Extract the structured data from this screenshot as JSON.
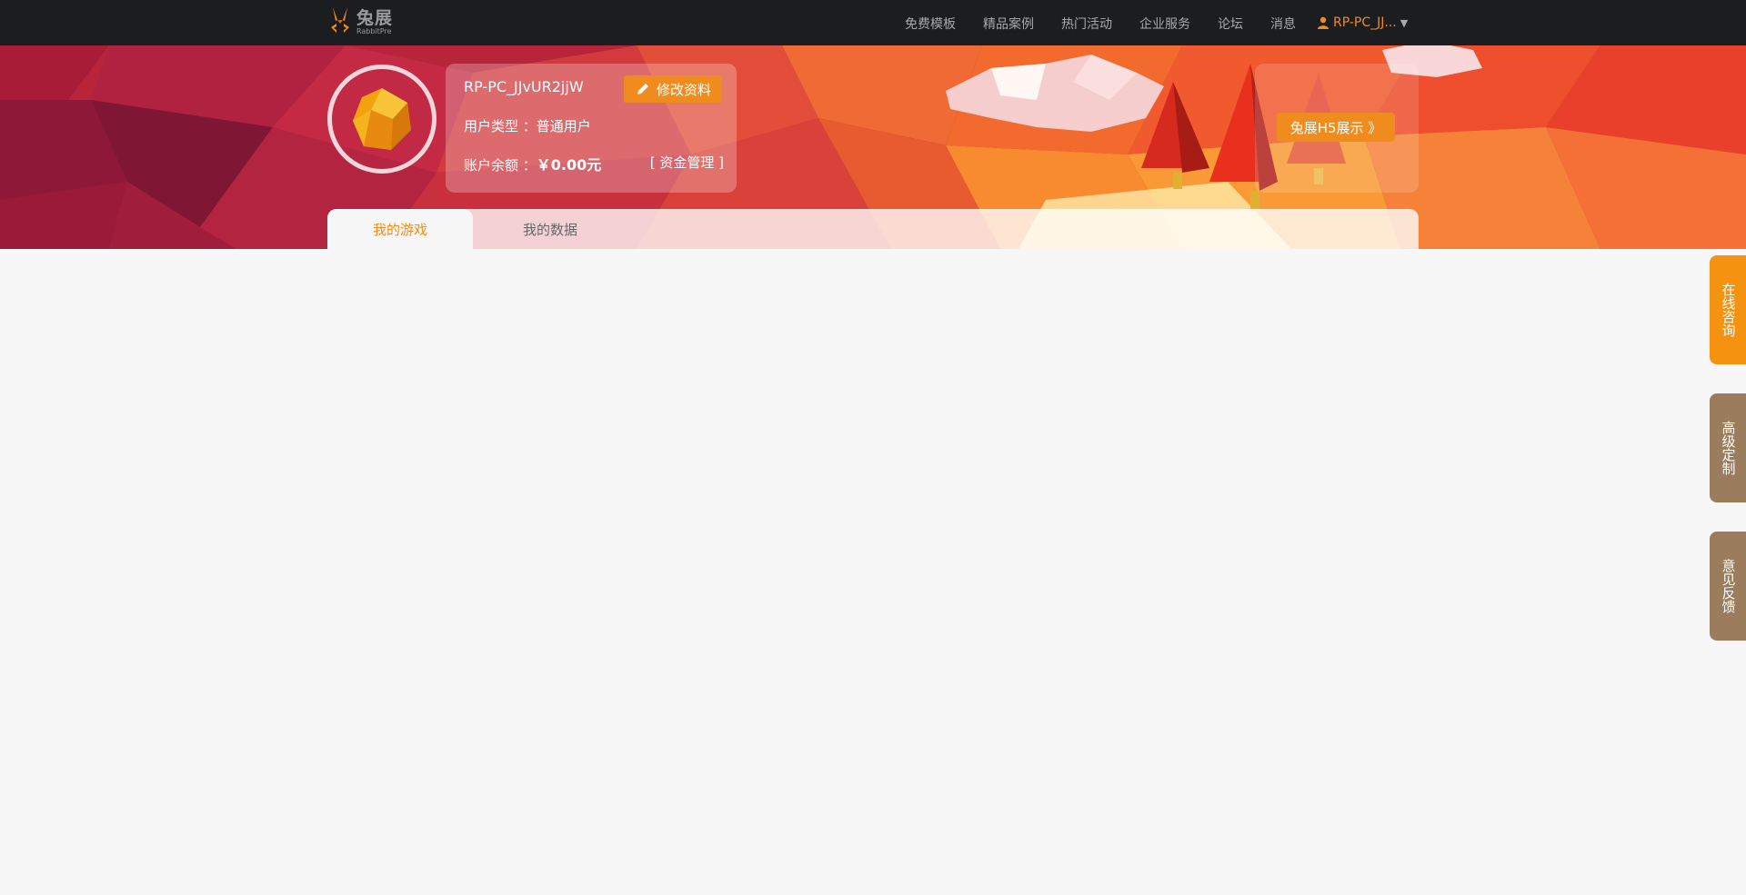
{
  "header": {
    "logo": {
      "cn": "兔展",
      "en": "RabbitPre"
    },
    "nav": [
      {
        "label": "免费模板"
      },
      {
        "label": "精品案例"
      },
      {
        "label": "热门活动"
      },
      {
        "label": "企业服务"
      },
      {
        "label": "论坛"
      },
      {
        "label": "消息"
      }
    ],
    "user": {
      "name": "RP-PC_JJ...",
      "icon": "person-icon",
      "caret": "▼"
    }
  },
  "profile": {
    "username": "RP-PC_JJvUR2jjW",
    "edit_label": "修改资料",
    "user_type_label": "用户类型 ：",
    "user_type_value": "普通用户",
    "balance_label": "账户余额 ：",
    "balance_value": "￥0.00元",
    "fund_link": "[ 资金管理 ]"
  },
  "promo": {
    "h5_label": "兔展H5展示 》"
  },
  "tabs": [
    {
      "label": "我的游戏",
      "active": true
    },
    {
      "label": "我的数据",
      "active": false
    }
  ],
  "side_buttons": [
    {
      "label": "在线咨询",
      "color": "#f5920f"
    },
    {
      "label": "高级定制",
      "color": "#9b7c5d"
    },
    {
      "label": "意见反馈",
      "color": "#9b7c5d"
    }
  ],
  "colors": {
    "accent": "#f08c1e",
    "nav_bg": "#1c1d21",
    "page_bg": "#f7f7f7"
  }
}
